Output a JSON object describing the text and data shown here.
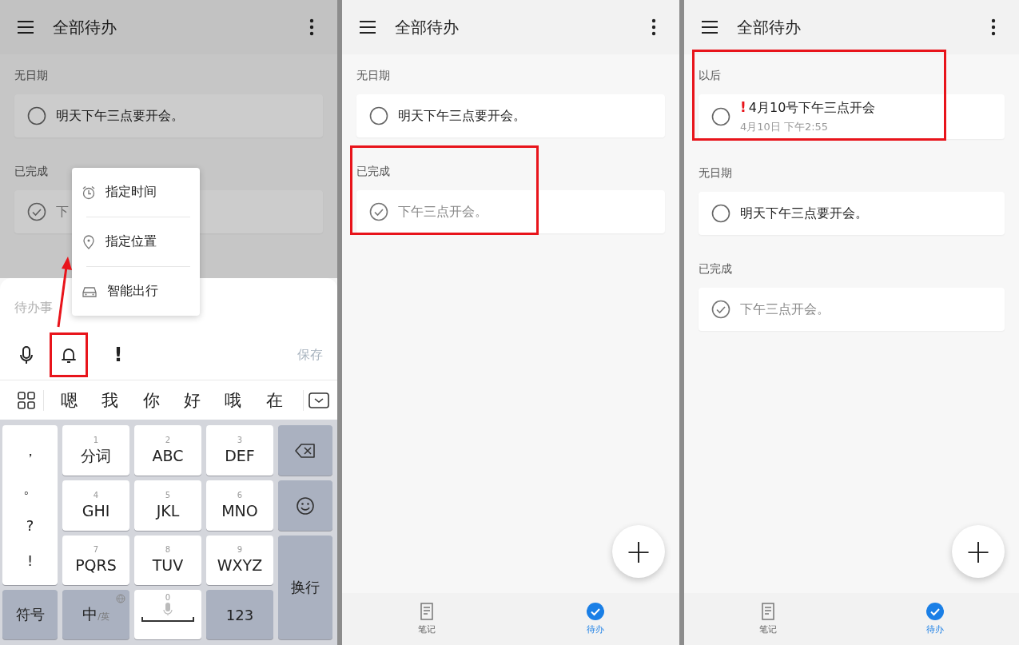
{
  "screens": [
    {
      "kind": "compose",
      "dimmed": true,
      "title": "全部待办",
      "sections": [
        {
          "label": "无日期",
          "highlighted": false,
          "items": [
            {
              "text": "明天下午三点要开会。",
              "done": false
            }
          ]
        },
        {
          "label": "已完成",
          "highlighted": false,
          "items": [
            {
              "text": "下",
              "done": true
            }
          ]
        }
      ],
      "menu": [
        {
          "kind": "clock",
          "label": "指定时间"
        },
        {
          "kind": "pin",
          "label": "指定位置"
        },
        {
          "kind": "car",
          "label": "智能出行"
        }
      ],
      "composer": {
        "placeholder": "待办事",
        "tools": [
          {
            "kind": "mic",
            "highlighted": false
          },
          {
            "kind": "bell",
            "highlighted": true
          },
          {
            "kind": "priority",
            "label": "!",
            "highlighted": false
          }
        ],
        "save": "保存",
        "save_disabled": true
      },
      "keyboard": {
        "candidates": [
          "嗯",
          "我",
          "你",
          "好",
          "哦",
          "在"
        ],
        "keys": [
          {
            "kind": "punct",
            "labels": [
              "，",
              "。",
              "?",
              "!"
            ]
          },
          {
            "kind": "letter",
            "digit": "1",
            "label": "分词"
          },
          {
            "kind": "letter",
            "digit": "2",
            "label": "ABC"
          },
          {
            "kind": "letter",
            "digit": "3",
            "label": "DEF"
          },
          {
            "kind": "backspace"
          },
          {
            "kind": "letter",
            "digit": "4",
            "label": "GHI"
          },
          {
            "kind": "letter",
            "digit": "5",
            "label": "JKL"
          },
          {
            "kind": "letter",
            "digit": "6",
            "label": "MNO"
          },
          {
            "kind": "emoji"
          },
          {
            "kind": "letter",
            "digit": "7",
            "label": "PQRS"
          },
          {
            "kind": "letter",
            "digit": "8",
            "label": "TUV"
          },
          {
            "kind": "letter",
            "digit": "9",
            "label": "WXYZ"
          },
          {
            "kind": "enter",
            "label": "换行"
          },
          {
            "kind": "function",
            "label": "符号"
          },
          {
            "kind": "lang",
            "label": "中",
            "sub": "/英"
          },
          {
            "kind": "space",
            "digit": "0"
          },
          {
            "kind": "function",
            "label": "123"
          }
        ]
      }
    },
    {
      "kind": "list",
      "title": "全部待办",
      "sections": [
        {
          "label": "无日期",
          "highlighted": false,
          "items": [
            {
              "text": "明天下午三点要开会。",
              "done": false
            }
          ]
        },
        {
          "label": "已完成",
          "highlighted": true,
          "items": [
            {
              "text": "下午三点开会。",
              "done": true
            }
          ]
        }
      ],
      "fab": "+",
      "nav": [
        {
          "kind": "notes",
          "label": "笔记",
          "selected": false
        },
        {
          "kind": "todo",
          "label": "待办",
          "selected": true
        }
      ]
    },
    {
      "kind": "list",
      "title": "全部待办",
      "sections": [
        {
          "label": "以后",
          "highlighted": true,
          "items": [
            {
              "text": "4月10号下午三点开会",
              "done": false,
              "flag": "!",
              "due": "4月10日 下午2:55"
            }
          ]
        },
        {
          "label": "无日期",
          "highlighted": false,
          "items": [
            {
              "text": "明天下午三点要开会。",
              "done": false
            }
          ]
        },
        {
          "label": "已完成",
          "highlighted": false,
          "items": [
            {
              "text": "下午三点开会。",
              "done": true
            }
          ]
        }
      ],
      "fab": "+",
      "nav": [
        {
          "kind": "notes",
          "label": "笔记",
          "selected": false
        },
        {
          "kind": "todo",
          "label": "待办",
          "selected": true
        }
      ]
    }
  ]
}
